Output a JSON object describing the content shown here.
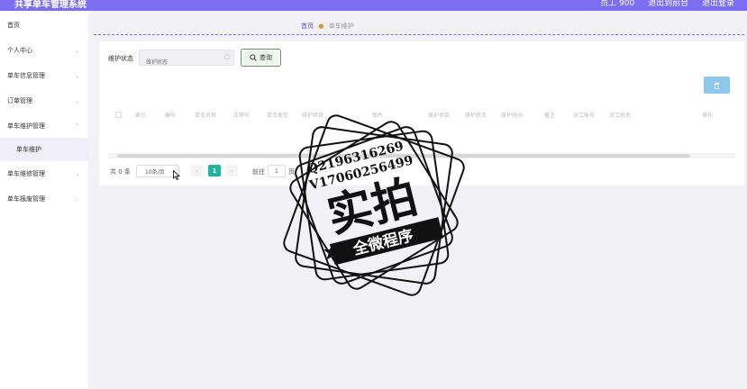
{
  "app": {
    "title": "共享单车管理系统",
    "user": "员工 900",
    "back_label": "退出到前台",
    "logout_label": "退出登录"
  },
  "sidebar": {
    "items": [
      {
        "label": "首页",
        "has_arrow": false
      },
      {
        "label": "个人中心",
        "has_arrow": true
      },
      {
        "label": "单车信息管理",
        "has_arrow": true
      },
      {
        "label": "订单管理",
        "has_arrow": true
      },
      {
        "label": "单车维护管理",
        "has_arrow": true
      },
      {
        "label": "单车维护",
        "has_arrow": false,
        "sub": true
      },
      {
        "label": "单车维修管理",
        "has_arrow": true
      },
      {
        "label": "单车报废管理",
        "has_arrow": true
      }
    ]
  },
  "breadcrumb": {
    "home": "首页",
    "current": "单车维护"
  },
  "search": {
    "label": "维护状态",
    "placeholder": "维护状态",
    "button_label": "查询"
  },
  "table": {
    "columns": [
      "索引",
      "编号",
      "单车名称",
      "车牌号",
      "单车类型",
      "维护项目",
      "图片",
      "维护项目",
      "维护状态",
      "维护时间",
      "备注",
      "员工账号",
      "员工姓名",
      "操作"
    ]
  },
  "pagination": {
    "total_label": "共 0 条",
    "page_size_label": "10条/页",
    "prev": "‹",
    "current_page": "1",
    "next": "›",
    "goto_label": "前往",
    "goto_value": "1",
    "goto_unit": "页"
  },
  "watermark": {
    "line1": "Q2196316269",
    "line2": "V17060256499",
    "main": "实拍",
    "ribbon": "全微程序"
  },
  "icons": {
    "search": "search-icon",
    "delete": "trash-icon",
    "dropdown": "chevron-down-icon"
  },
  "colors": {
    "topbar": "#7d6df0",
    "accent": "#5a4fd0",
    "page_active": "#1fb5a0",
    "delete_button": "#8ec7ec"
  }
}
